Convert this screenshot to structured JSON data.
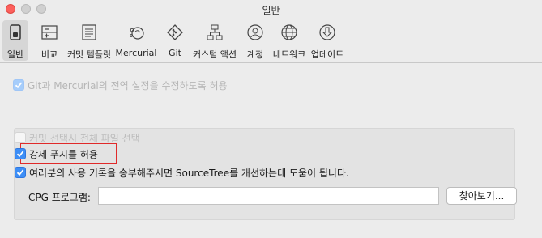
{
  "window": {
    "title": "일반"
  },
  "toolbar": {
    "tabs": [
      {
        "label": "일반",
        "icon": "general-switch-icon",
        "active": true
      },
      {
        "label": "비교",
        "icon": "compare-icon",
        "active": false
      },
      {
        "label": "커밋 템플릿",
        "icon": "commit-template-icon",
        "active": false
      },
      {
        "label": "Mercurial",
        "icon": "mercurial-icon",
        "active": false
      },
      {
        "label": "Git",
        "icon": "git-icon",
        "active": false
      },
      {
        "label": "커스텀 액션",
        "icon": "custom-actions-icon",
        "active": false
      },
      {
        "label": "계정",
        "icon": "account-icon",
        "active": false
      },
      {
        "label": "네트워크",
        "icon": "network-globe-icon",
        "active": false
      },
      {
        "label": "업데이트",
        "icon": "update-download-icon",
        "active": false
      }
    ]
  },
  "global_settings_checkbox": {
    "label": "Git과 Mercurial의 전역 설정을 수정하도록 허용",
    "checked": true,
    "enabled": false
  },
  "options": {
    "select_all_files": {
      "label": "커밋 선택시 전체 파일 선택",
      "checked": false,
      "enabled": false
    },
    "allow_force_push": {
      "label": "강제 푸시를 허용",
      "checked": true,
      "enabled": true
    },
    "usage_stats": {
      "label": "여러분의 사용 기록을 송부해주시면 SourceTree를 개선하는데 도움이 됩니다.",
      "checked": true,
      "enabled": true
    }
  },
  "cpg": {
    "label": "CPG 프로그램:",
    "value": "",
    "browse_label": "찾아보기..."
  },
  "colors": {
    "accent": "#3d8ef6",
    "highlight": "#e02a2a",
    "window_bg": "#ececec"
  }
}
